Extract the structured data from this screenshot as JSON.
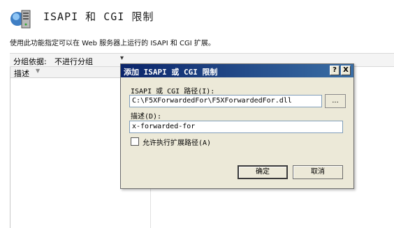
{
  "header": {
    "title": "ISAPI 和 CGI 限制",
    "icon": "server-restrictions-icon"
  },
  "description": "使用此功能指定可以在 Web 服务器上运行的 ISAPI 和 CGI 扩展。",
  "toolbar": {
    "group_by_label": "分组依据:",
    "group_by_value": "不进行分组"
  },
  "list": {
    "columns": [
      "描述"
    ]
  },
  "dialog": {
    "title": "添加 ISAPI 或 CGI 限制",
    "help_button": "?",
    "close_button": "X",
    "path_label": "ISAPI 或 CGI 路径(I):",
    "path_value": "C:\\F5XForwardedFor\\F5XForwardedFor.dll",
    "browse_label": "...",
    "description_label": "描述(D):",
    "description_value": "x-forwarded-for",
    "checkbox_label": "允许执行扩展路径(A)",
    "checkbox_checked": false,
    "ok_label": "确定",
    "cancel_label": "取消"
  },
  "colors": {
    "title_bar_start": "#0a246a",
    "title_bar_end": "#3a6ea5",
    "dialog_bg": "#ece9d8"
  }
}
